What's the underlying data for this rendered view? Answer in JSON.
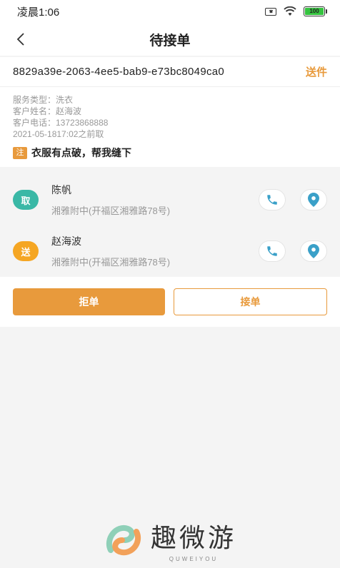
{
  "status_bar": {
    "time": "凌晨1:06",
    "battery": "100"
  },
  "nav": {
    "title": "待接单"
  },
  "order": {
    "id": "8829a39e-2063-4ee5-bab9-e73bc8049ca0",
    "type": "送件",
    "service_type": "服务类型：洗衣",
    "customer_name": "客户姓名：赵海波",
    "customer_phone": "客户电话：13723868888",
    "deadline": "2021-05-1817:02之前取",
    "note_tag": "注",
    "note_text": "衣服有点破，帮我缝下"
  },
  "contacts": [
    {
      "badge": "取",
      "name": "陈帆",
      "address": "湘雅附中(开福区湘雅路78号)"
    },
    {
      "badge": "送",
      "name": "赵海波",
      "address": "湘雅附中(开福区湘雅路78号)"
    }
  ],
  "actions": {
    "reject": "拒单",
    "accept": "接单"
  },
  "watermark": {
    "title": "趣微游",
    "subtitle": "QUWEIYOU"
  },
  "colors": {
    "accent": "#e89a3c",
    "pick": "#3ab8a6",
    "send": "#f5a623",
    "icon": "#3aa0c8"
  }
}
